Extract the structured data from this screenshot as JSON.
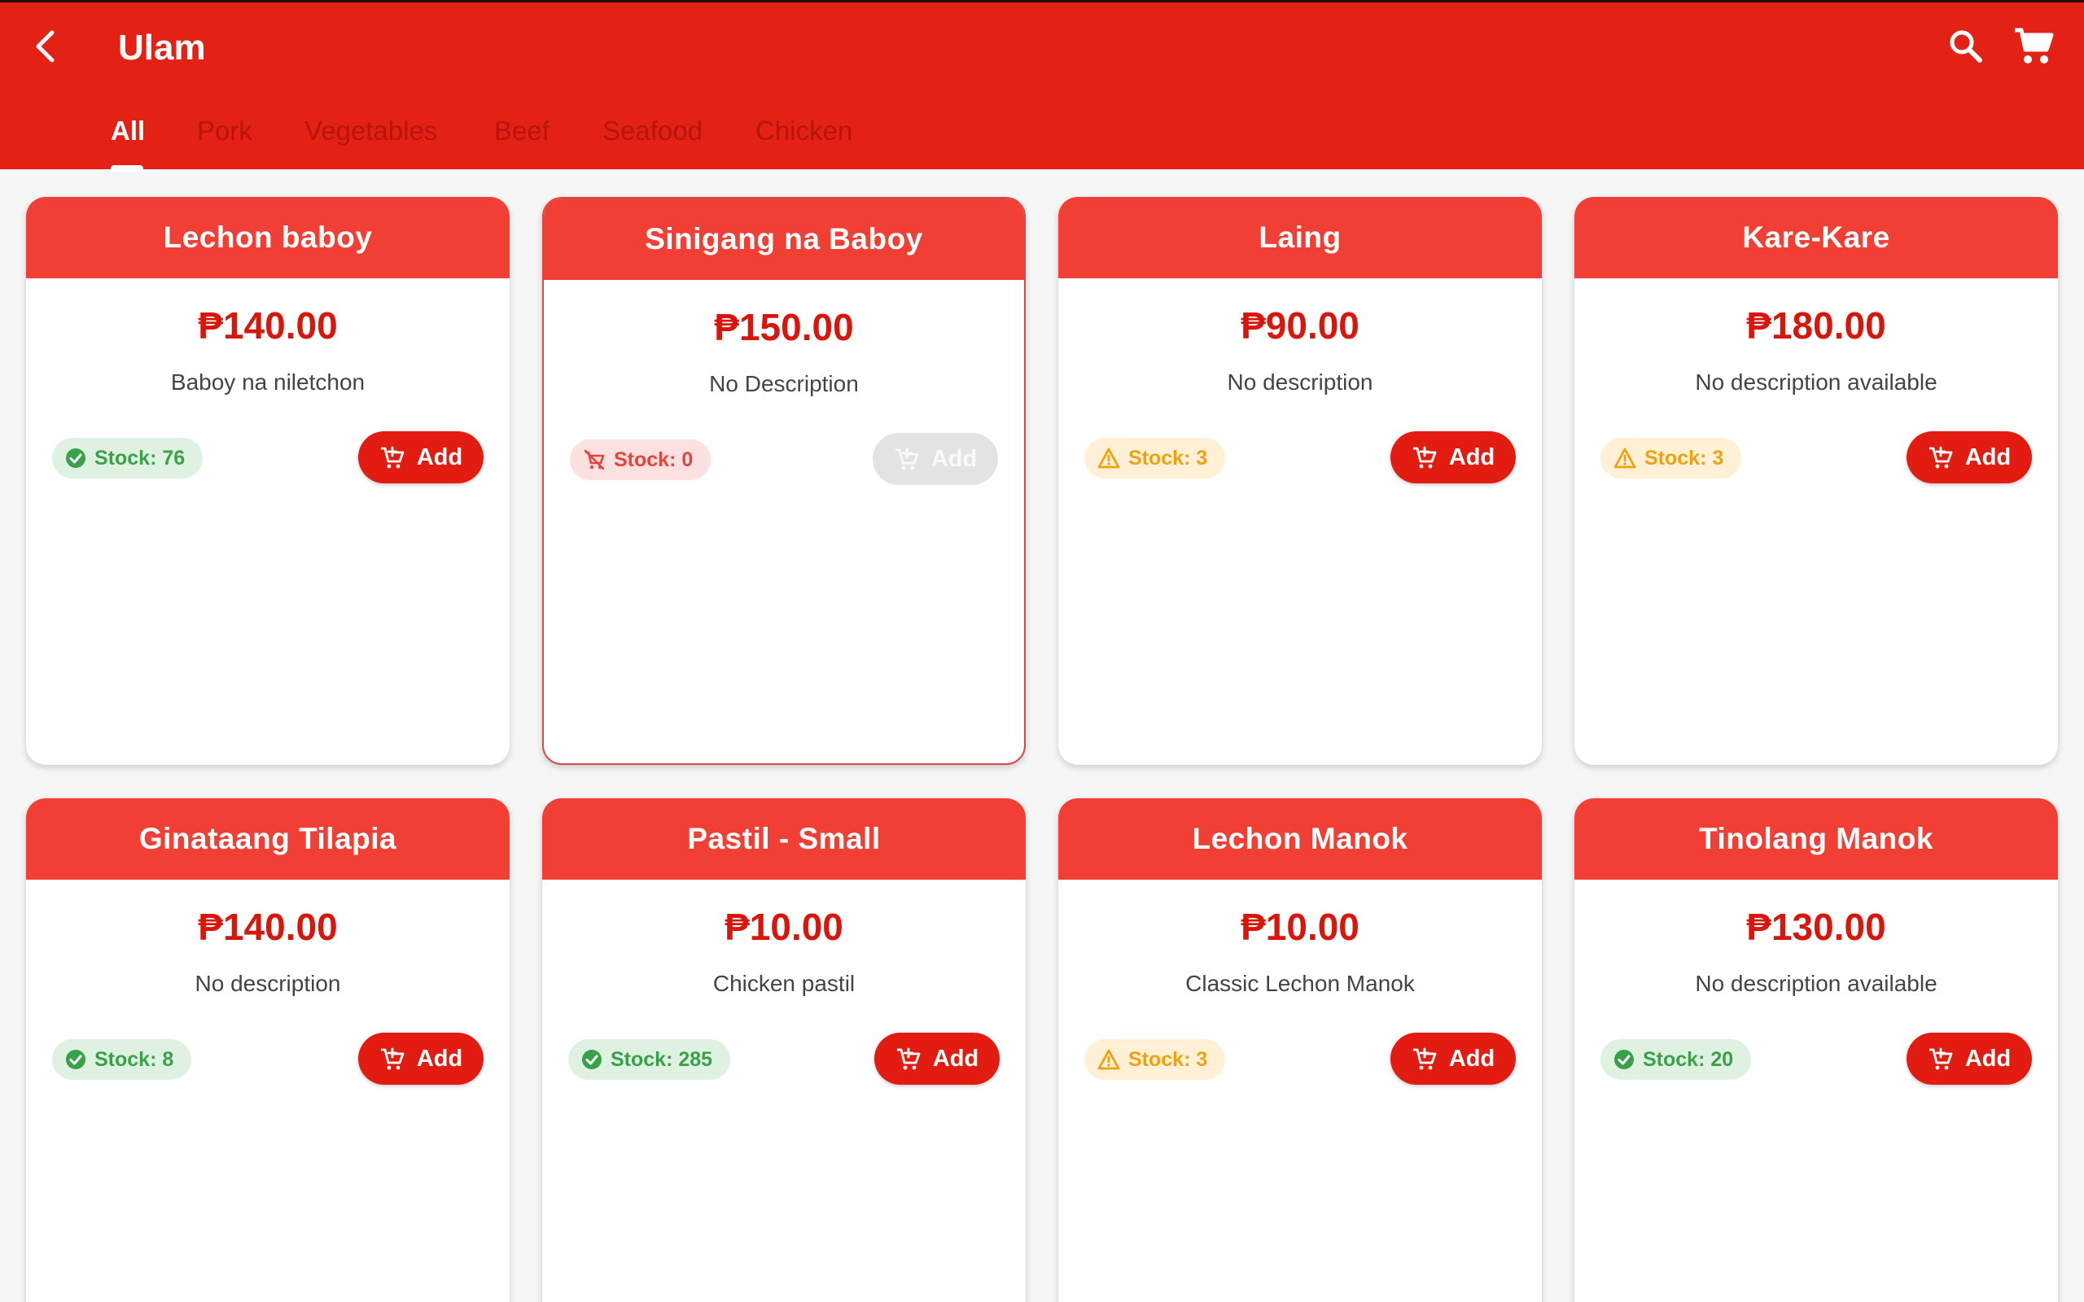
{
  "appbar": {
    "title": "Ulam",
    "icons": {
      "back": "back-arrow-icon",
      "search": "search-icon",
      "cart": "cart-icon"
    },
    "color": "#e32114"
  },
  "tabs": [
    {
      "label": "All",
      "active": true
    },
    {
      "label": "Pork",
      "active": false
    },
    {
      "label": "Vegetables",
      "active": false
    },
    {
      "label": "Beef",
      "active": false
    },
    {
      "label": "Seafood",
      "active": false
    },
    {
      "label": "Chicken",
      "active": false
    }
  ],
  "products": [
    {
      "name": "Lechon baboy",
      "price": "₱140.00",
      "description": "Baboy na niletchon",
      "stock": "Stock: 76",
      "stock_status": "ok",
      "add_label": "Add",
      "add_enabled": true
    },
    {
      "name": "Sinigang na Baboy",
      "price": "₱150.00",
      "description": "No Description",
      "stock": "Stock: 0",
      "stock_status": "out",
      "add_label": "Add",
      "add_enabled": false
    },
    {
      "name": "Laing",
      "price": "₱90.00",
      "description": "No description",
      "stock": "Stock: 3",
      "stock_status": "low",
      "add_label": "Add",
      "add_enabled": true
    },
    {
      "name": "Kare-Kare",
      "price": "₱180.00",
      "description": "No description available",
      "stock": "Stock: 3",
      "stock_status": "low",
      "add_label": "Add",
      "add_enabled": true
    },
    {
      "name": "Ginataang Tilapia",
      "price": "₱140.00",
      "description": "No description",
      "stock": "Stock: 8",
      "stock_status": "ok",
      "add_label": "Add",
      "add_enabled": true
    },
    {
      "name": "Pastil - Small",
      "price": "₱10.00",
      "description": "Chicken pastil",
      "stock": "Stock: 285",
      "stock_status": "ok",
      "add_label": "Add",
      "add_enabled": true
    },
    {
      "name": "Lechon Manok",
      "price": "₱10.00",
      "description": "Classic Lechon Manok",
      "stock": "Stock: 3",
      "stock_status": "low",
      "add_label": "Add",
      "add_enabled": true
    },
    {
      "name": "Tinolang Manok",
      "price": "₱130.00",
      "description": "No description available",
      "stock": "Stock: 20",
      "stock_status": "ok",
      "add_label": "Add",
      "add_enabled": true
    }
  ],
  "colors": {
    "card_header": "#f23f36",
    "price": "#d8160c",
    "stock_ok": "#38a149",
    "stock_low": "#f0a20e",
    "stock_out": "#e5443d"
  }
}
